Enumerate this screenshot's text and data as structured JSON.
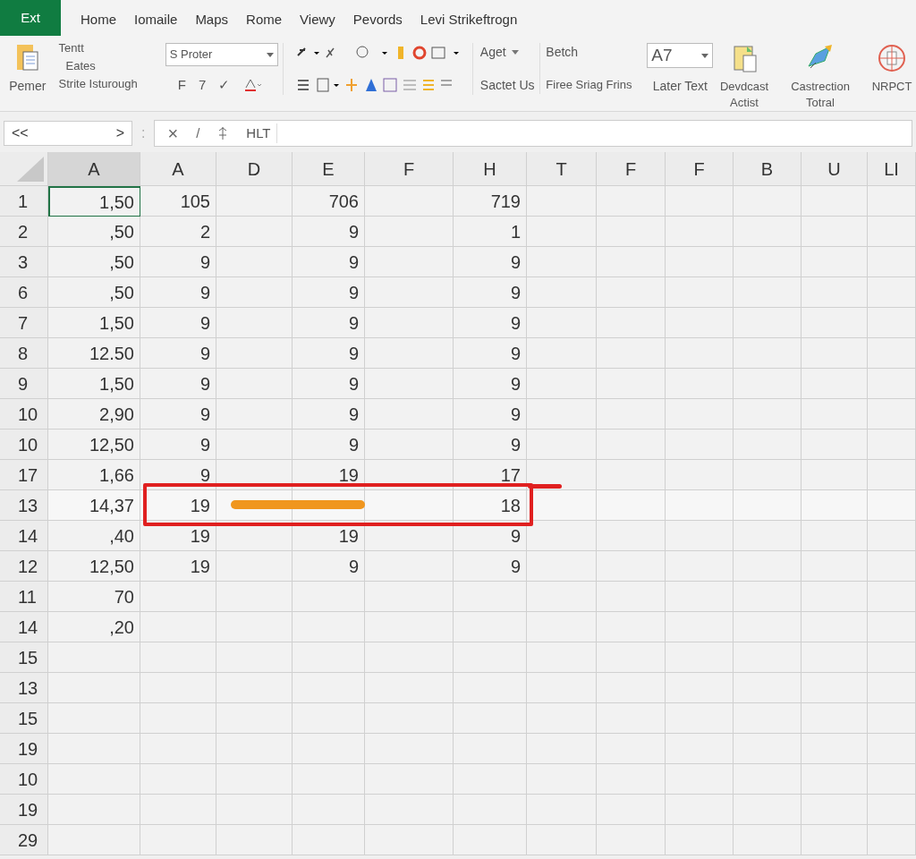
{
  "app_button": "Ext",
  "tabs": [
    {
      "label": "Home",
      "selected": false
    },
    {
      "label": "Iomaile",
      "selected": false
    },
    {
      "label": "Maps",
      "selected": false
    },
    {
      "label": "Rome",
      "selected": false
    },
    {
      "label": "Viewy",
      "selected": false
    },
    {
      "label": "Pevords",
      "selected": false
    },
    {
      "label": "Levi Strikeftrogn",
      "selected": false
    }
  ],
  "ribbon": {
    "paste_label": "Pemer",
    "clipboard_items": [
      "Tentt",
      "Eates",
      "Strite Isturough"
    ],
    "font_box": "S Proter",
    "font_buttons": [
      "F",
      "7",
      "✓"
    ],
    "aget": "Aget",
    "sactet": "Sactet Us",
    "betch": "Betch",
    "firee": "Firee Sriag Frins",
    "cell_box": "A7",
    "later_text": "Later Text",
    "big_buttons": [
      {
        "kind": "document",
        "label": "Devdcast Actist"
      },
      {
        "kind": "pencil",
        "label": "Castrection Totral"
      },
      {
        "kind": "globe",
        "label": "NRPCT"
      }
    ]
  },
  "formula_bar": {
    "name_box_left": "<<",
    "name_box_right": ">",
    "separator": ":",
    "cancel": "×",
    "enter": "/",
    "value": "HLT"
  },
  "columns": [
    {
      "label": "A",
      "selected": true
    },
    {
      "label": "A",
      "selected": false
    },
    {
      "label": "D",
      "selected": false
    },
    {
      "label": "E",
      "selected": false
    },
    {
      "label": "F",
      "selected": false
    },
    {
      "label": "H",
      "selected": false
    },
    {
      "label": "T",
      "selected": false
    },
    {
      "label": "F",
      "selected": false
    },
    {
      "label": "F",
      "selected": false
    },
    {
      "label": "B",
      "selected": false
    },
    {
      "label": "U",
      "selected": false
    },
    {
      "label": "LI",
      "selected": false
    }
  ],
  "rows": [
    {
      "label": "1",
      "selected": true,
      "highlighted": false,
      "cells": {
        "column_1": "1,50",
        "column_2": "105",
        "column_4": "706",
        "column_6": "719"
      }
    },
    {
      "label": "2",
      "selected": false,
      "highlighted": false,
      "cells": {
        "column_1": ",50",
        "column_2": "2",
        "column_4": "9",
        "column_6": "1"
      }
    },
    {
      "label": "3",
      "selected": false,
      "highlighted": false,
      "cells": {
        "column_1": ",50",
        "column_2": "9",
        "column_4": "9",
        "column_6": "9"
      }
    },
    {
      "label": "6",
      "selected": false,
      "highlighted": false,
      "cells": {
        "column_1": ",50",
        "column_2": "9",
        "column_4": "9",
        "column_6": "9"
      }
    },
    {
      "label": "7",
      "selected": false,
      "highlighted": false,
      "cells": {
        "column_1": "1,50",
        "column_2": "9",
        "column_4": "9",
        "column_6": "9"
      }
    },
    {
      "label": "8",
      "selected": false,
      "highlighted": false,
      "cells": {
        "column_1": "12.50",
        "column_2": "9",
        "column_4": "9",
        "column_6": "9"
      }
    },
    {
      "label": "9",
      "selected": false,
      "highlighted": false,
      "cells": {
        "column_1": "1,50",
        "column_2": "9",
        "column_4": "9",
        "column_6": "9"
      }
    },
    {
      "label": "10",
      "selected": false,
      "highlighted": false,
      "cells": {
        "column_1": "2,90",
        "column_2": "9",
        "column_4": "9",
        "column_6": "9"
      }
    },
    {
      "label": "10",
      "selected": false,
      "highlighted": false,
      "cells": {
        "column_1": "12,50",
        "column_2": "9",
        "column_4": "9",
        "column_6": "9"
      }
    },
    {
      "label": "17",
      "selected": false,
      "highlighted": false,
      "cells": {
        "column_1": "1,66",
        "column_2": "9",
        "column_4": "19",
        "column_6": "17"
      }
    },
    {
      "label": "13",
      "selected": false,
      "highlighted": true,
      "cells": {
        "column_1": "14,37",
        "column_2": "19",
        "column_6": "18"
      }
    },
    {
      "label": "14",
      "selected": false,
      "highlighted": false,
      "cells": {
        "column_1": ",40",
        "column_2": "19",
        "column_4": "19",
        "column_6": "9"
      }
    },
    {
      "label": "12",
      "selected": false,
      "highlighted": false,
      "cells": {
        "column_1": "12,50",
        "column_2": "19",
        "column_4": "9",
        "column_6": "9"
      }
    },
    {
      "label": "11",
      "selected": false,
      "highlighted": false,
      "cells": {
        "column_1": "70"
      }
    },
    {
      "label": "14",
      "selected": false,
      "highlighted": false,
      "cells": {
        "column_1": ",20"
      }
    },
    {
      "label": "15",
      "selected": false,
      "highlighted": false,
      "cells": {}
    },
    {
      "label": "13",
      "selected": false,
      "highlighted": false,
      "cells": {}
    },
    {
      "label": "15",
      "selected": false,
      "highlighted": false,
      "cells": {}
    },
    {
      "label": "19",
      "selected": false,
      "highlighted": false,
      "cells": {}
    },
    {
      "label": "10",
      "selected": false,
      "highlighted": false,
      "cells": {}
    },
    {
      "label": "19",
      "selected": false,
      "highlighted": false,
      "cells": {}
    },
    {
      "label": "29",
      "selected": false,
      "highlighted": false,
      "cells": {}
    }
  ]
}
